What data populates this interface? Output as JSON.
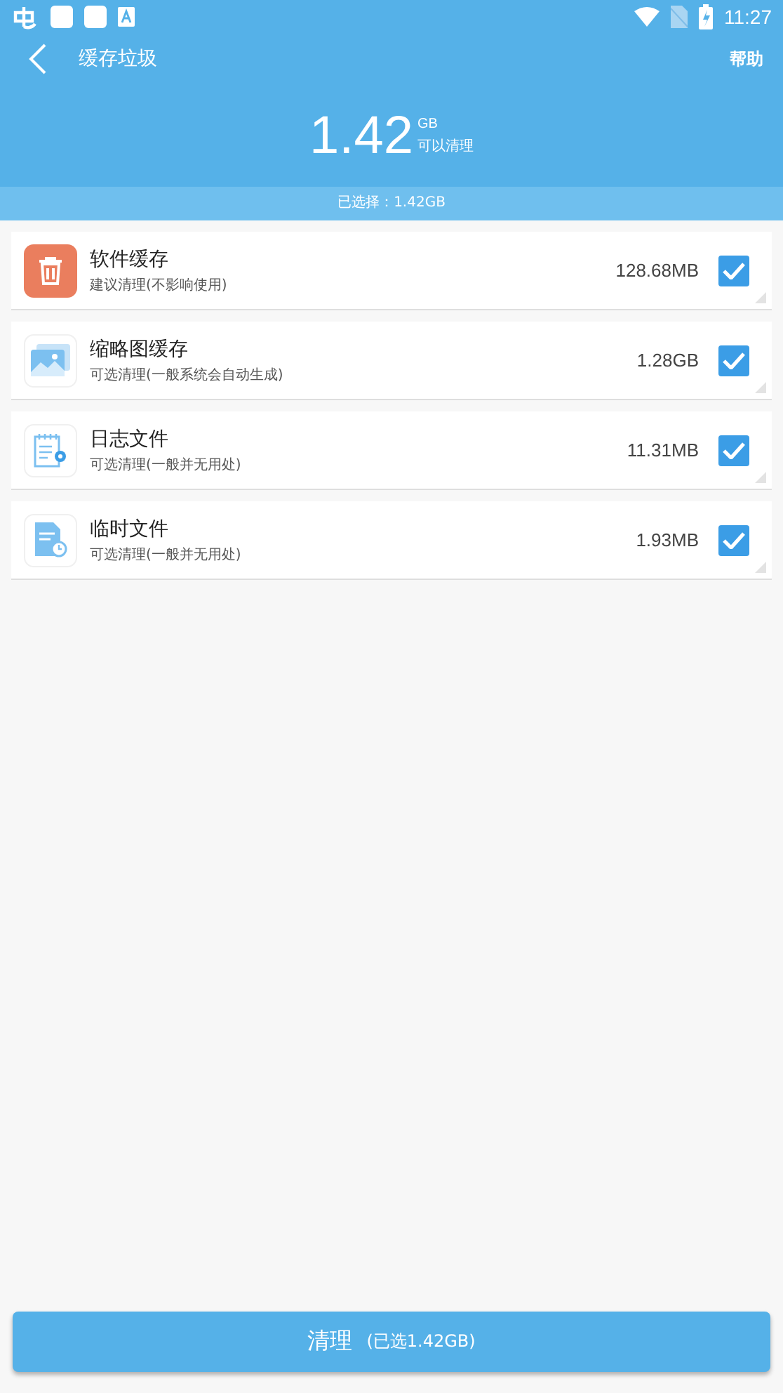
{
  "status_bar": {
    "time": "11:27",
    "left_icons": [
      {
        "kind": "ime"
      },
      {
        "kind": "square"
      },
      {
        "kind": "square"
      },
      {
        "kind": "a"
      }
    ]
  },
  "app_bar": {
    "title": "缓存垃圾",
    "action": "帮助"
  },
  "summary": {
    "amount": "1.42",
    "unit": "GB",
    "caption": "可以清理",
    "selected_text": "已选择：1.42GB"
  },
  "items": [
    {
      "kind": "trash",
      "title": "软件缓存",
      "subtitle": "建议清理(不影响使用)",
      "size": "128.68MB",
      "checked": true
    },
    {
      "kind": "image",
      "title": "缩略图缓存",
      "subtitle": "可选清理(一般系统会自动生成)",
      "size": "1.28GB",
      "checked": true
    },
    {
      "kind": "log",
      "title": "日志文件",
      "subtitle": "可选清理(一般并无用处)",
      "size": "11.31MB",
      "checked": true
    },
    {
      "kind": "temp",
      "title": "临时文件",
      "subtitle": "可选清理(一般并无用处)",
      "size": "1.93MB",
      "checked": true
    }
  ],
  "clean_button": {
    "label": "清理",
    "detail": "(已选1.42GB)"
  }
}
